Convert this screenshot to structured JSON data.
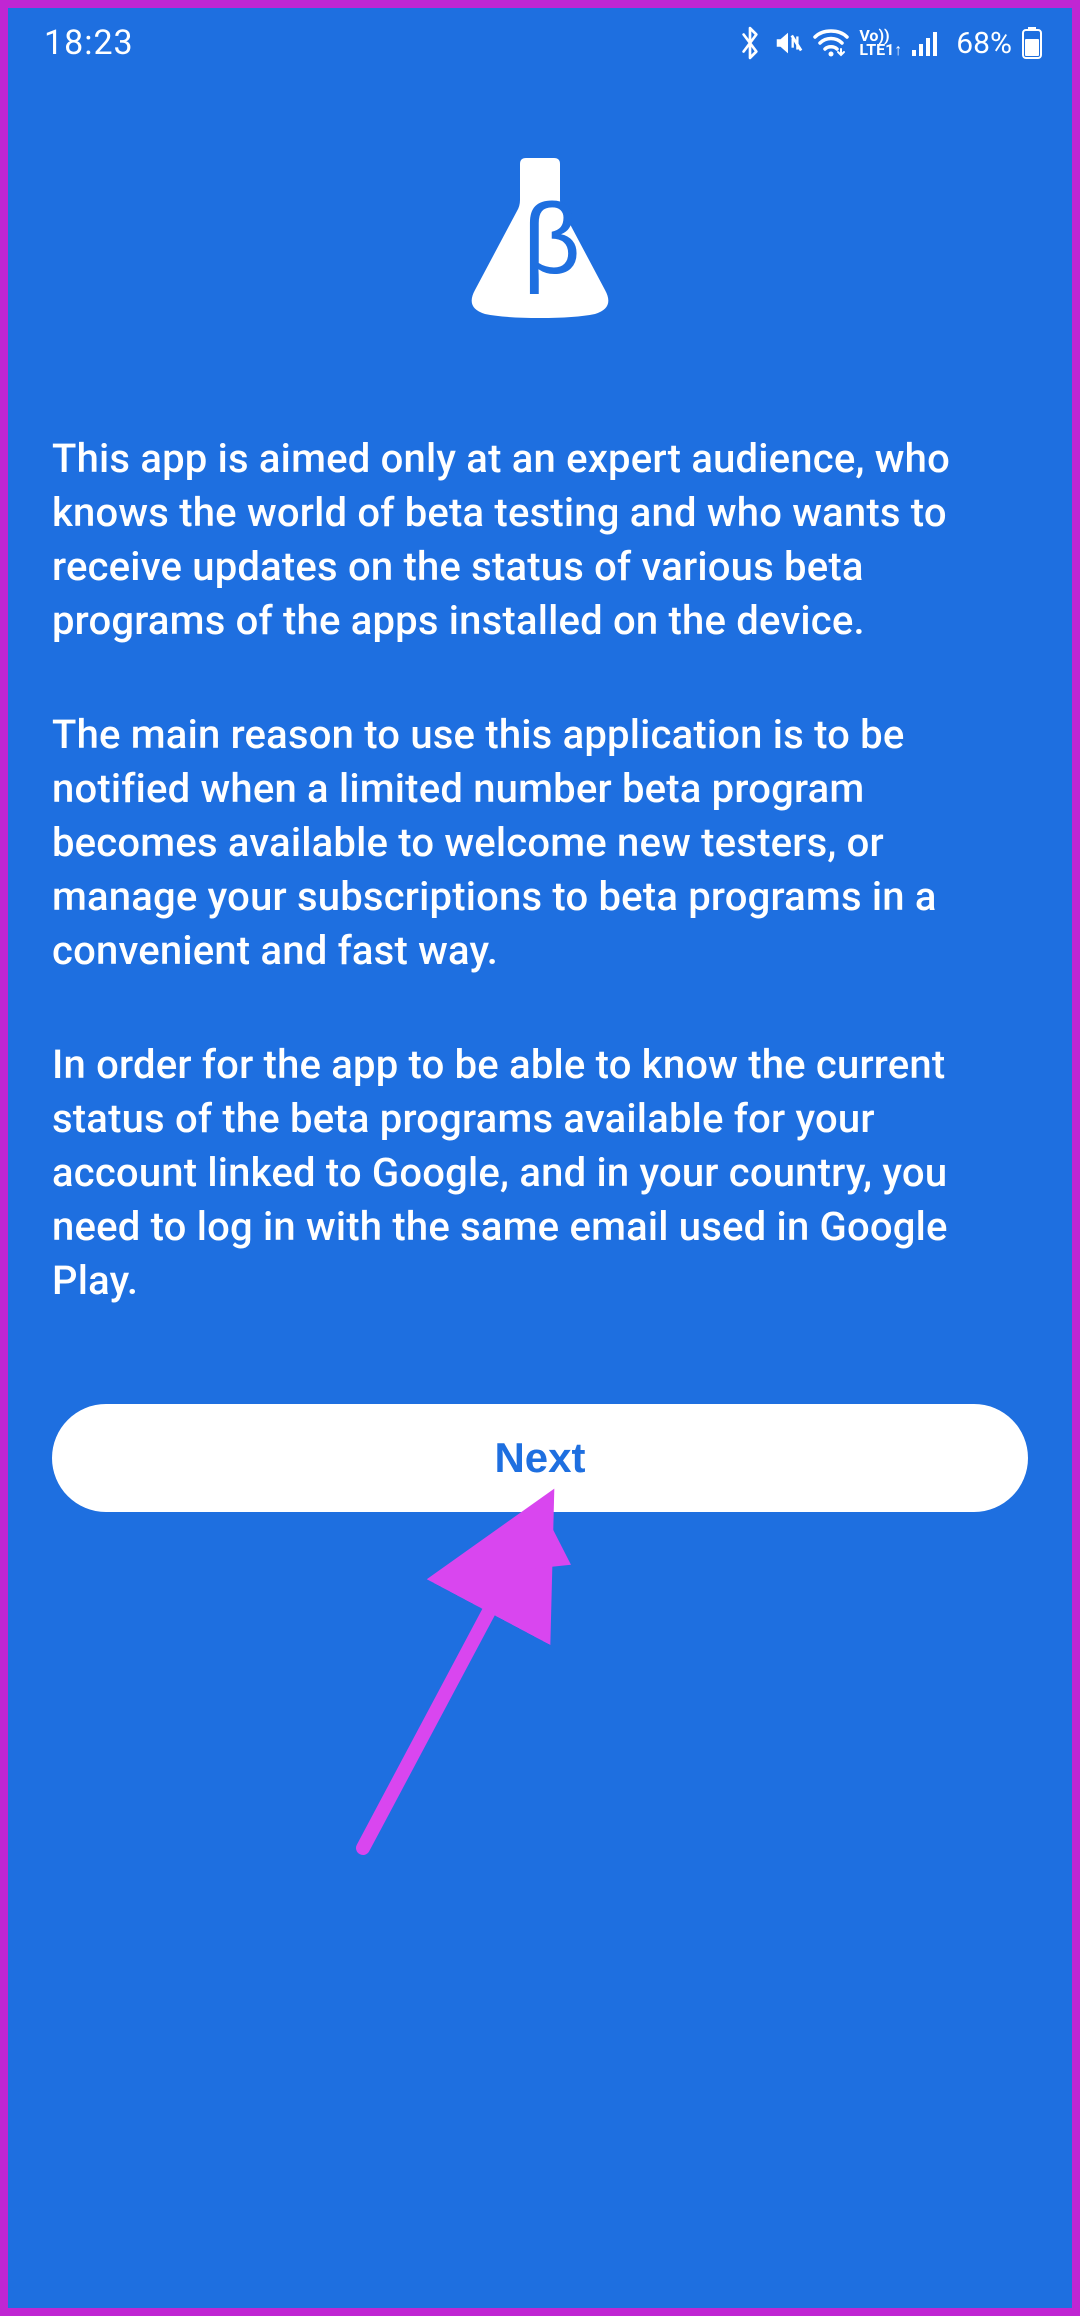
{
  "status_bar": {
    "time": "18:23",
    "network_label_top": "Vo))",
    "network_label_bottom": "LTE1",
    "battery_percent": "68%"
  },
  "content": {
    "paragraph1": "This app is aimed only at an expert audience, who knows the world of beta testing and who wants to receive updates on the status of various beta programs of the apps installed on the device.",
    "paragraph2": "The main reason to use this application is to be notified when a limited number beta program becomes available to welcome new testers, or manage your subscriptions to beta programs in a convenient and fast way.",
    "paragraph3": "In order for the app to be able to know the current status of the beta programs available for your account linked to Google, and in your country, you need to log in with the same email used in Google Play."
  },
  "buttons": {
    "next": "Next"
  }
}
